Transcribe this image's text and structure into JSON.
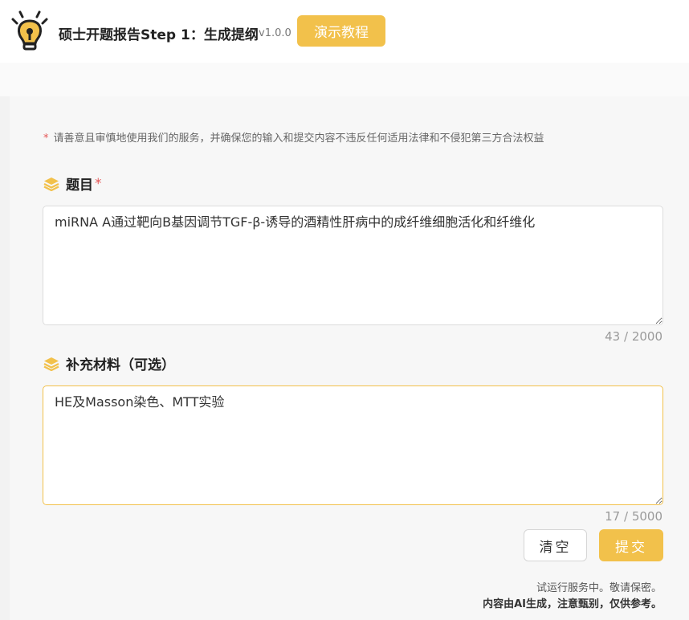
{
  "header": {
    "title": "硕士开题报告Step 1：生成提纲",
    "version": "v1.0.0",
    "demo_button": "演示教程"
  },
  "notice": {
    "text": "请善意且审慎地使用我们的服务，并确保您的输入和提交内容不违反任何适用法律和不侵犯第三方合法权益"
  },
  "topic": {
    "label": "题目",
    "required_mark": "*",
    "value": "miRNA A通过靶向B基因调节TGF-β-诱导的酒精性肝病中的成纤维细胞活化和纤维化",
    "counter": "43 / 2000"
  },
  "materials": {
    "label": "补充材料（可选）",
    "value": "HE及Masson染色、MTT实验",
    "counter": "17 / 5000"
  },
  "actions": {
    "clear_label": "清空",
    "submit_label": "提交"
  },
  "footer": {
    "line1": "试运行服务中。敬请保密。",
    "line2": "内容由AI生成，注意甄别，仅供参考。"
  },
  "colors": {
    "accent": "#f2c14b",
    "required": "#e45656"
  }
}
